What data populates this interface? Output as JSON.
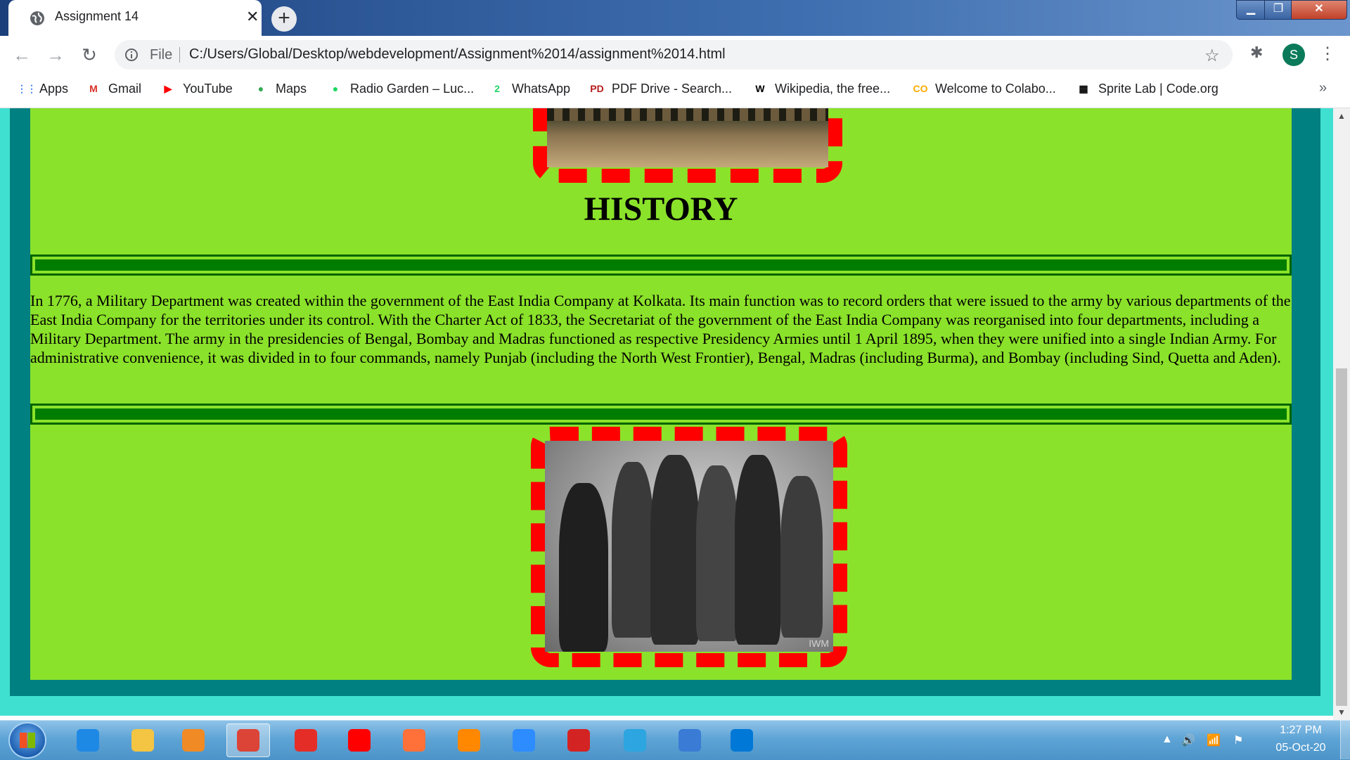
{
  "browser": {
    "tab_title": "Assignment 14",
    "tab_close": "✕",
    "new_tab": "+",
    "file_label": "File",
    "url": "C:/Users/Global/Desktop/webdevelopment/Assignment%2014/assignment%2014.html",
    "profile_initial": "S",
    "bookmarks": [
      {
        "label": "Apps",
        "icon": "apps-grid-icon",
        "glyph": "⋮⋮",
        "color": "#4285f4"
      },
      {
        "label": "Gmail",
        "icon": "gmail-icon",
        "glyph": "M",
        "color": "#d93025"
      },
      {
        "label": "YouTube",
        "icon": "youtube-icon",
        "glyph": "▶",
        "color": "#ff0000"
      },
      {
        "label": "Maps",
        "icon": "maps-pin-icon",
        "glyph": "●",
        "color": "#34a853"
      },
      {
        "label": "Radio Garden – Luc...",
        "icon": "radio-garden-icon",
        "glyph": "●",
        "color": "#1ed760"
      },
      {
        "label": "WhatsApp",
        "icon": "whatsapp-icon",
        "glyph": "2",
        "color": "#25d366"
      },
      {
        "label": "PDF Drive - Search...",
        "icon": "pdf-drive-icon",
        "glyph": "PD",
        "color": "#b71c1c"
      },
      {
        "label": "Wikipedia, the free...",
        "icon": "wikipedia-icon",
        "glyph": "W",
        "color": "#000000"
      },
      {
        "label": "Welcome to Colabo...",
        "icon": "colab-icon",
        "glyph": "CO",
        "color": "#f9ab00"
      },
      {
        "label": "Sprite Lab | Code.org",
        "icon": "code-org-icon",
        "glyph": "▦",
        "color": "#000000"
      }
    ],
    "more_bookmarks": "»"
  },
  "page": {
    "heading": "HISTORY",
    "paragraph": "In 1776, a Military Department was created within the government of the East India Company at Kolkata. Its main function was to record orders that were issued to the army by various departments of the East India Company for the territories under its control. With the Charter Act of 1833, the Secretariat of the government of the East India Company was reorganised into four departments, including a Military Department. The army in the presidencies of Bengal, Bombay and Madras functioned as respective Presidency Armies until 1 April 1895, when they were unified into a single Indian Army. For administrative convenience, it was divided in to four commands, namely Punjab (including the North West Frontier), Bengal, Madras (including Burma), and Bombay (including Sind, Quetta and Aden).",
    "image_watermark": "IWM",
    "colors": {
      "background": "#8be22a",
      "outer_border": "#40e0d0",
      "mid_border": "#008080",
      "dashed_frame": "#ff0000",
      "rule": "#007d00"
    }
  },
  "taskbar": {
    "apps": [
      {
        "name": "internet-explorer-icon",
        "color": "#1e88e5"
      },
      {
        "name": "file-explorer-icon",
        "color": "#f4c542"
      },
      {
        "name": "media-player-icon",
        "color": "#f08a24"
      },
      {
        "name": "chrome-icon",
        "color": "#db4437",
        "active": true
      },
      {
        "name": "youtube-app-icon",
        "color": "#e52d27"
      },
      {
        "name": "youtube-music-icon",
        "color": "#ff0000"
      },
      {
        "name": "firefox-icon",
        "color": "#ff7139"
      },
      {
        "name": "vlc-icon",
        "color": "#ff8800"
      },
      {
        "name": "zoom-icon",
        "color": "#2d8cff"
      },
      {
        "name": "acrobat-icon",
        "color": "#d42323"
      },
      {
        "name": "telegram-icon",
        "color": "#2ca5e0"
      },
      {
        "name": "remote-desktop-icon",
        "color": "#3a7bd5"
      },
      {
        "name": "vscode-icon",
        "color": "#0078d7"
      }
    ],
    "clock_time": "1:27 PM",
    "clock_date": "05-Oct-20"
  }
}
